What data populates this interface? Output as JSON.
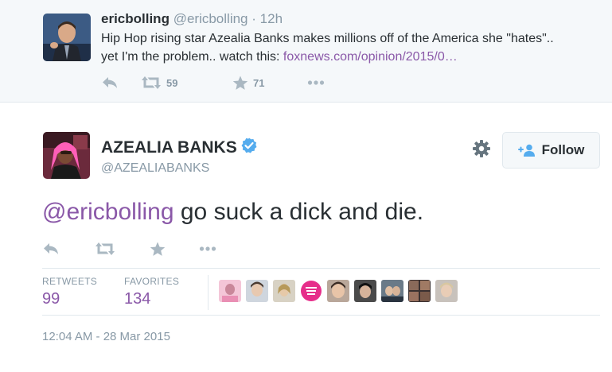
{
  "reply_to_tweet": {
    "fullname": "ericbolling",
    "username": "@ericbolling",
    "dot": "·",
    "time": "12h",
    "text_line1": "Hip Hop rising star Azealia Banks makes millions off of the America she \"hates\"..",
    "text_line2_prefix": "yet I'm the problem.. watch this: ",
    "link": "foxnews.com/opinion/2015/0…",
    "retweets": "59",
    "favorites": "71"
  },
  "tweet": {
    "fullname": "AZEALIA BANKS",
    "username": "@AZEALIABANKS",
    "follow_label": "Follow",
    "mention": "@ericbolling",
    "text": " go suck a dick and die.",
    "stats": {
      "retweets_label": "RETWEETS",
      "retweets_value": "99",
      "favorites_label": "FAVORITES",
      "favorites_value": "134"
    },
    "timestamp": "12:04 AM - 28 Mar 2015"
  },
  "colors": {
    "link": "#8a58a8",
    "verified": "#55acee",
    "muted": "#8899a6",
    "icon": "#aab8c2"
  },
  "icons": {
    "reply": "reply-icon",
    "retweet": "retweet-icon",
    "favorite": "star-icon",
    "more": "more-icon",
    "settings": "gear-icon",
    "follow": "add-user-icon",
    "verified": "verified-badge-icon"
  }
}
